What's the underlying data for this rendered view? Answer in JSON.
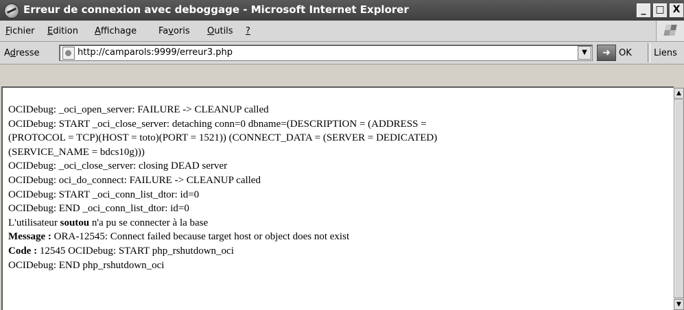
{
  "window": {
    "title": "Erreur de connexion avec deboggage - Microsoft Internet Explorer",
    "buttons": {
      "minimize": "_",
      "maximize": "□",
      "close": "X"
    }
  },
  "menubar": {
    "items": [
      {
        "label": "Fichier",
        "mnemonic": "F",
        "rest": "ichier"
      },
      {
        "label": "Edition",
        "mnemonic": "E",
        "rest": "dition"
      },
      {
        "label": "Affichage",
        "mnemonic": "A",
        "rest": "ffichage"
      },
      {
        "label": "Favoris",
        "pre": "Fa",
        "mnemonic": "v",
        "rest": "oris"
      },
      {
        "label": "Outils",
        "mnemonic": "O",
        "rest": "utils"
      },
      {
        "label": "?",
        "mnemonic": "?",
        "rest": ""
      }
    ]
  },
  "addressbar": {
    "label_pre": "A",
    "label_mnemonic": "d",
    "label_rest": "resse",
    "url": "http://camparols:9999/erreur3.php",
    "go_label": "OK",
    "links_label": "Liens"
  },
  "content": {
    "lines": [
      "OCIDebug: _oci_open_server: FAILURE -> CLEANUP called",
      "OCIDebug: START _oci_close_server: detaching conn=0 dbname=(DESCRIPTION = (ADDRESS =",
      "(PROTOCOL = TCP)(HOST = toto)(PORT = 1521)) (CONNECT_DATA = (SERVER = DEDICATED)",
      "(SERVICE_NAME = bdcs10g)))",
      "OCIDebug: _oci_close_server: closing DEAD server",
      "OCIDebug: oci_do_connect: FAILURE -> CLEANUP called",
      "OCIDebug: START _oci_conn_list_dtor: id=0",
      "OCIDebug: END _oci_conn_list_dtor: id=0"
    ],
    "user_line": {
      "pre": "L'utilisateur ",
      "user": "soutou",
      "post": " n'a pu se connecter à la base"
    },
    "message_line": {
      "label": "Message :",
      "text": " ORA-12545: Connect failed because target host or object does not exist"
    },
    "code_line": {
      "label": "Code :",
      "text": " 12545 OCIDebug: START php_rshutdown_oci"
    },
    "last_line": "OCIDebug: END php_rshutdown_oci"
  }
}
